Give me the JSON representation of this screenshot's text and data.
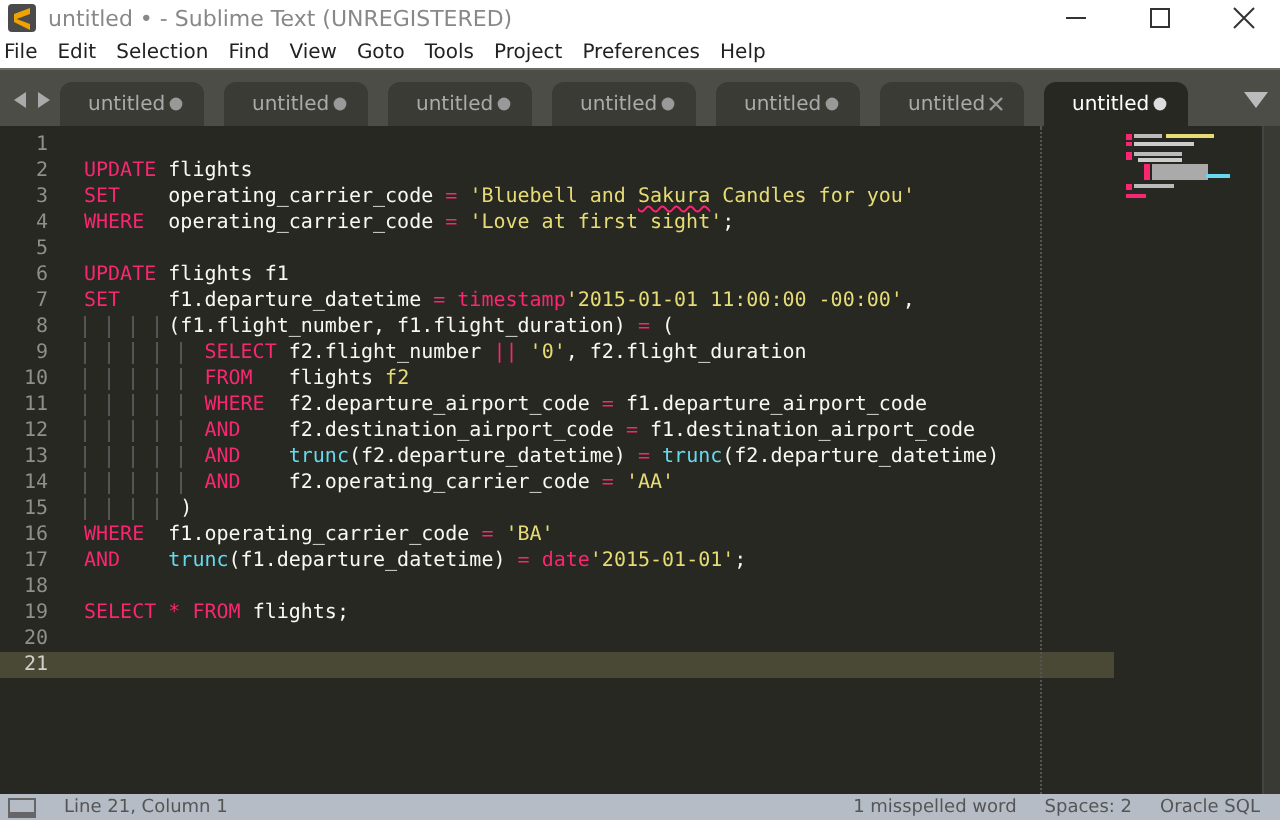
{
  "window": {
    "title": "untitled • - Sublime Text (UNREGISTERED)"
  },
  "menu": [
    "File",
    "Edit",
    "Selection",
    "Find",
    "View",
    "Goto",
    "Tools",
    "Project",
    "Preferences",
    "Help"
  ],
  "tabs": [
    {
      "label": "untitled",
      "selected": false,
      "modified": true
    },
    {
      "label": "untitled",
      "selected": false,
      "modified": true
    },
    {
      "label": "untitled",
      "selected": false,
      "modified": true
    },
    {
      "label": "untitled",
      "selected": false,
      "modified": true
    },
    {
      "label": "untitled",
      "selected": false,
      "modified": true
    },
    {
      "label": "untitled",
      "selected": false,
      "modified": false
    },
    {
      "label": "untitled",
      "selected": true,
      "modified": true
    }
  ],
  "editor": {
    "lines": [
      {
        "number": "1",
        "current": false
      },
      {
        "number": "2",
        "current": false,
        "tokens": [
          {
            "text": "UPDATE ",
            "kind": "kw"
          },
          {
            "text": "flights",
            "kind": "plain"
          }
        ]
      },
      {
        "number": "3",
        "current": false,
        "tokens": [
          {
            "text": "SET    ",
            "kind": "kw"
          },
          {
            "text": "operating_carrier_code ",
            "kind": "plain"
          },
          {
            "text": "= ",
            "kind": "op"
          },
          {
            "text": "'Bluebell and ",
            "kind": "str"
          },
          {
            "text": "Sakura",
            "kind": "typo"
          },
          {
            "text": " Candles for you'",
            "kind": "str"
          }
        ]
      },
      {
        "number": "4",
        "current": false,
        "tokens": [
          {
            "text": "WHERE  ",
            "kind": "kw"
          },
          {
            "text": "operating_carrier_code ",
            "kind": "plain"
          },
          {
            "text": "= ",
            "kind": "op"
          },
          {
            "text": "'Love at first sight'",
            "kind": "str"
          },
          {
            "text": ";",
            "kind": "plain"
          }
        ]
      },
      {
        "number": "5",
        "current": false
      },
      {
        "number": "6",
        "current": false,
        "tokens": [
          {
            "text": "UPDATE ",
            "kind": "kw"
          },
          {
            "text": "flights f1",
            "kind": "plain"
          }
        ]
      },
      {
        "number": "7",
        "current": false,
        "tokens": [
          {
            "text": "SET    ",
            "kind": "kw"
          },
          {
            "text": "f1.departure_datetime ",
            "kind": "plain"
          },
          {
            "text": "= ",
            "kind": "op"
          },
          {
            "text": "timestamp",
            "kind": "kw"
          },
          {
            "text": "'2015-01-01 11:00:00 -00:00'",
            "kind": "str"
          },
          {
            "text": ",",
            "kind": "plain"
          }
        ]
      },
      {
        "number": "8",
        "current": false,
        "tokens": [
          {
            "text": "       (f1.flight_number, f1.flight_duration) ",
            "kind": "plain"
          },
          {
            "text": "= ",
            "kind": "op"
          },
          {
            "text": "(",
            "kind": "plain"
          }
        ]
      },
      {
        "number": "9",
        "current": false,
        "tokens": [
          {
            "text": "          SELECT ",
            "kind": "kw"
          },
          {
            "text": "f2.flight_number ",
            "kind": "plain"
          },
          {
            "text": "|| ",
            "kind": "op"
          },
          {
            "text": "'0'",
            "kind": "str"
          },
          {
            "text": ", f2.flight_duration",
            "kind": "plain"
          }
        ]
      },
      {
        "number": "10",
        "current": false,
        "tokens": [
          {
            "text": "          FROM   ",
            "kind": "kw"
          },
          {
            "text": "flights ",
            "kind": "plain"
          },
          {
            "text": "f2",
            "kind": "str"
          }
        ]
      },
      {
        "number": "11",
        "current": false,
        "tokens": [
          {
            "text": "          WHERE  ",
            "kind": "kw"
          },
          {
            "text": "f2.departure_airport_code ",
            "kind": "plain"
          },
          {
            "text": "= ",
            "kind": "op"
          },
          {
            "text": "f1.departure_airport_code",
            "kind": "plain"
          }
        ]
      },
      {
        "number": "12",
        "current": false,
        "tokens": [
          {
            "text": "          AND    ",
            "kind": "kw"
          },
          {
            "text": "f2.destination_airport_code ",
            "kind": "plain"
          },
          {
            "text": "= ",
            "kind": "op"
          },
          {
            "text": "f1.destination_airport_code",
            "kind": "plain"
          }
        ]
      },
      {
        "number": "13",
        "current": false,
        "tokens": [
          {
            "text": "          AND    ",
            "kind": "kw"
          },
          {
            "text": "trunc",
            "kind": "fn"
          },
          {
            "text": "(f2.departure_datetime) ",
            "kind": "plain"
          },
          {
            "text": "= ",
            "kind": "op"
          },
          {
            "text": "trunc",
            "kind": "fn"
          },
          {
            "text": "(f2.departure_datetime)",
            "kind": "plain"
          }
        ]
      },
      {
        "number": "14",
        "current": false,
        "tokens": [
          {
            "text": "          AND    ",
            "kind": "kw"
          },
          {
            "text": "f2.operating_carrier_code ",
            "kind": "plain"
          },
          {
            "text": "= ",
            "kind": "op"
          },
          {
            "text": "'AA'",
            "kind": "str"
          }
        ]
      },
      {
        "number": "15",
        "current": false,
        "tokens": [
          {
            "text": "        )",
            "kind": "plain"
          }
        ]
      },
      {
        "number": "16",
        "current": false,
        "tokens": [
          {
            "text": "WHERE  ",
            "kind": "kw"
          },
          {
            "text": "f1.operating_carrier_code ",
            "kind": "plain"
          },
          {
            "text": "= ",
            "kind": "op"
          },
          {
            "text": "'BA'",
            "kind": "str"
          }
        ]
      },
      {
        "number": "17",
        "current": false,
        "tokens": [
          {
            "text": "AND    ",
            "kind": "kw"
          },
          {
            "text": "trunc",
            "kind": "fn"
          },
          {
            "text": "(f1.departure_datetime) ",
            "kind": "plain"
          },
          {
            "text": "= ",
            "kind": "op"
          },
          {
            "text": "date",
            "kind": "kw"
          },
          {
            "text": "'2015-01-01'",
            "kind": "str"
          },
          {
            "text": ";",
            "kind": "plain"
          }
        ]
      },
      {
        "number": "18",
        "current": false
      },
      {
        "number": "19",
        "current": false,
        "tokens": [
          {
            "text": "SELECT ",
            "kind": "kw"
          },
          {
            "text": "* ",
            "kind": "op"
          },
          {
            "text": "FROM ",
            "kind": "kw"
          },
          {
            "text": "flights;",
            "kind": "plain"
          }
        ]
      },
      {
        "number": "20",
        "current": false
      },
      {
        "number": "21",
        "current": true
      }
    ]
  },
  "status_bar": {
    "position": "Line 21, Column 1",
    "spelling": "1 misspelled word",
    "indentation": "Spaces: 2",
    "syntax": "Oracle SQL"
  }
}
